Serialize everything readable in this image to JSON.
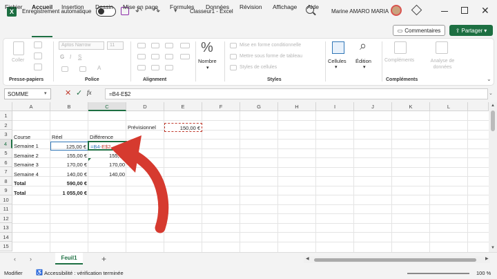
{
  "titlebar": {
    "autosave_label": "Enregistrement automatique",
    "document_title": "Classeur1 - Excel",
    "user_name": "Marine AMARO MARIA"
  },
  "menu": {
    "tabs": [
      "Fichier",
      "Accueil",
      "Insertion",
      "Dessin",
      "Mise en page",
      "Formules",
      "Données",
      "Révision",
      "Affichage",
      "Aide"
    ],
    "active": "Accueil",
    "comments_label": "Commentaires",
    "share_label": "Partager"
  },
  "ribbon": {
    "clipboard": {
      "group": "Presse-papiers",
      "paste": "Coller"
    },
    "font": {
      "group": "Police",
      "font_name": "Aptos Narrow",
      "font_size": "11"
    },
    "alignment": {
      "group": "Alignment"
    },
    "number": {
      "group": "",
      "label": "Nombre"
    },
    "styles": {
      "group": "Styles",
      "conditional": "Mise en forme conditionnelle",
      "as_table": "Mettre sous forme de tableau",
      "cell_styles": "Styles de cellules"
    },
    "cells": {
      "label": "Cellules"
    },
    "editing": {
      "label": "Édition"
    },
    "addins": {
      "group": "Compléments",
      "label": "Compléments",
      "analysis": "Analyse de données"
    }
  },
  "formula_bar": {
    "name_box": "SOMME",
    "formula": "=B4-E$2"
  },
  "grid": {
    "columns": [
      "A",
      "B",
      "C",
      "D",
      "E",
      "F",
      "G",
      "H",
      "I",
      "J",
      "K",
      "L"
    ],
    "rows": [
      "1",
      "2",
      "3",
      "4",
      "5",
      "6",
      "7",
      "8",
      "9",
      "10",
      "11",
      "12",
      "13",
      "14",
      "15"
    ],
    "cells": {
      "D2": "Prévisionnel",
      "E2": "150,00 €",
      "A3": "Course",
      "B3": "Réel",
      "C3": "Différence",
      "A4": "Semaine 1",
      "B4": "125,00 €",
      "C4_part1": "=B4-",
      "C4_part2": "E$2",
      "A5": "Semaine 2",
      "B5": "155,00 €",
      "C5": "155,00",
      "A6": "Semaine 3",
      "B6": "170,00 €",
      "C6": "170,00",
      "A7": "Semaine 4",
      "B7": "140,00 €",
      "C7": "140,00",
      "A8": "Total",
      "B8": "590,00 €",
      "A9": "Total",
      "B9": "1 055,00 €"
    }
  },
  "sheets": {
    "active": "Feuil1",
    "add": "+"
  },
  "status": {
    "mode": "Modifier",
    "accessibility": "Accessibilité : vérification terminée",
    "zoom": "100 %"
  },
  "colors": {
    "accent": "#1d6f42",
    "arrow": "#d63a2f",
    "ref_blue": "#2e75b6",
    "ref_red": "#c0392b"
  }
}
